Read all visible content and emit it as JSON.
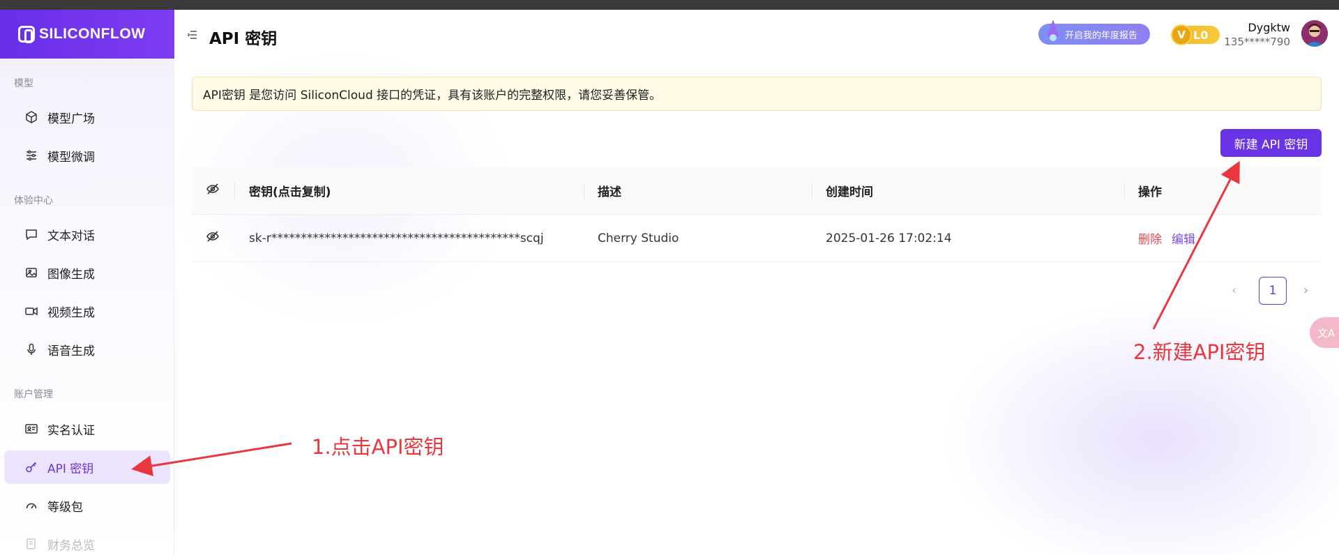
{
  "app": {
    "logo_text": "SILICONFLOW"
  },
  "sidebar": {
    "sections": [
      {
        "title": "模型"
      },
      {
        "title": "体验中心"
      },
      {
        "title": "账户管理"
      }
    ],
    "items": [
      {
        "label": "模型广场",
        "icon": "cube-icon"
      },
      {
        "label": "模型微调",
        "icon": "sliders-icon"
      },
      {
        "label": "文本对话",
        "icon": "chat-bubble-icon"
      },
      {
        "label": "图像生成",
        "icon": "image-icon"
      },
      {
        "label": "视频生成",
        "icon": "video-camera-icon"
      },
      {
        "label": "语音生成",
        "icon": "microphone-icon"
      },
      {
        "label": "实名认证",
        "icon": "id-card-icon"
      },
      {
        "label": "API 密钥",
        "icon": "key-icon",
        "active": true
      },
      {
        "label": "等级包",
        "icon": "gauge-icon"
      },
      {
        "label": "财务总览",
        "icon": "finance-icon"
      }
    ]
  },
  "header": {
    "title": "API 密钥",
    "annual_report_label": "开启我的年度报告",
    "level_badge": "L0",
    "level_badge_icon": "V",
    "user_name": "Dygktw",
    "user_phone": "135*****790"
  },
  "notice": {
    "text": "API密钥 是您访问 SiliconCloud 接口的凭证，具有该账户的完整权限，请您妥善保管。"
  },
  "actions": {
    "new_key_label": "新建 API 密钥"
  },
  "table": {
    "columns": [
      "密钥(点击复制)",
      "描述",
      "创建时间",
      "操作"
    ],
    "rows": [
      {
        "key": "sk-r******************************************scqj",
        "description": "Cherry Studio",
        "created_at": "2025-01-26 17:02:14",
        "delete_label": "删除",
        "edit_label": "编辑"
      }
    ]
  },
  "pagination": {
    "current_page": "1",
    "prev": "‹",
    "next": "›"
  },
  "translate_fab": "文A",
  "annotations": {
    "step1": "1.点击API密钥",
    "step2": "2.新建API密钥"
  },
  "colors": {
    "brand": "#6a33e6",
    "annotation": "#e8383d",
    "danger": "#e5484d"
  }
}
